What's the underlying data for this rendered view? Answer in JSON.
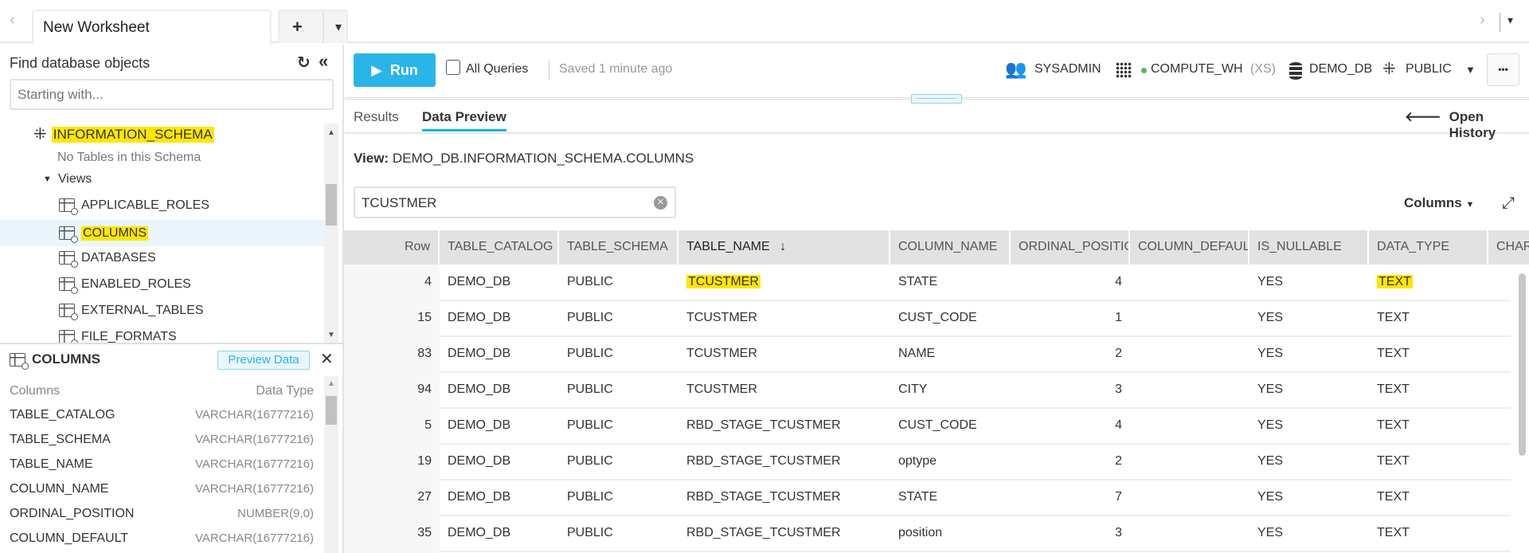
{
  "tabs": {
    "active": "New Worksheet",
    "add": "+",
    "menu": "▾",
    "nav_left": "‹",
    "nav_right": "›"
  },
  "left": {
    "title": "Find database objects",
    "search_placeholder": "Starting with...",
    "schema": "INFORMATION_SCHEMA",
    "no_tables": "No Tables in this Schema",
    "views_label": "Views",
    "views": [
      "APPLICABLE_ROLES",
      "COLUMNS",
      "DATABASES",
      "ENABLED_ROLES",
      "EXTERNAL_TABLES",
      "FILE_FORMATS"
    ],
    "detail": {
      "title": "COLUMNS",
      "preview_button": "Preview Data",
      "close": "✕",
      "col_header": "Columns",
      "type_header": "Data Type",
      "columns": [
        {
          "name": "TABLE_CATALOG",
          "type": "VARCHAR(16777216)"
        },
        {
          "name": "TABLE_SCHEMA",
          "type": "VARCHAR(16777216)"
        },
        {
          "name": "TABLE_NAME",
          "type": "VARCHAR(16777216)"
        },
        {
          "name": "COLUMN_NAME",
          "type": "VARCHAR(16777216)"
        },
        {
          "name": "ORDINAL_POSITION",
          "type": "NUMBER(9,0)"
        },
        {
          "name": "COLUMN_DEFAULT",
          "type": "VARCHAR(16777216)"
        }
      ]
    }
  },
  "toolbar": {
    "run": "Run",
    "all_queries": "All Queries",
    "saved": "Saved 1 minute ago",
    "role": "SYSADMIN",
    "warehouse": "COMPUTE_WH",
    "warehouse_size": "(XS)",
    "database": "DEMO_DB",
    "schema": "PUBLIC",
    "more": "•••"
  },
  "results": {
    "tabs": [
      "Results",
      "Data Preview"
    ],
    "open_history": "Open History",
    "view_label": "View:",
    "view_name": "DEMO_DB.INFORMATION_SCHEMA.COLUMNS",
    "filter_value": "TCUSTMER",
    "columns_button": "Columns",
    "headers": [
      "Row",
      "TABLE_CATALOG",
      "TABLE_SCHEMA",
      "TABLE_NAME",
      "COLUMN_NAME",
      "ORDINAL_POSITION",
      "COLUMN_DEFAULT",
      "IS_NULLABLE",
      "DATA_TYPE",
      "CHARACTER_MAXIMUM_LENGTH"
    ],
    "sort_indicator": "↓",
    "rows": [
      [
        "4",
        "DEMO_DB",
        "PUBLIC",
        "TCUSTMER",
        "STATE",
        "4",
        "",
        "YES",
        "TEXT"
      ],
      [
        "15",
        "DEMO_DB",
        "PUBLIC",
        "TCUSTMER",
        "CUST_CODE",
        "1",
        "",
        "YES",
        "TEXT"
      ],
      [
        "83",
        "DEMO_DB",
        "PUBLIC",
        "TCUSTMER",
        "NAME",
        "2",
        "",
        "YES",
        "TEXT"
      ],
      [
        "94",
        "DEMO_DB",
        "PUBLIC",
        "TCUSTMER",
        "CITY",
        "3",
        "",
        "YES",
        "TEXT"
      ],
      [
        "5",
        "DEMO_DB",
        "PUBLIC",
        "RBD_STAGE_TCUSTMER",
        "CUST_CODE",
        "4",
        "",
        "YES",
        "TEXT"
      ],
      [
        "19",
        "DEMO_DB",
        "PUBLIC",
        "RBD_STAGE_TCUSTMER",
        "optype",
        "2",
        "",
        "YES",
        "TEXT"
      ],
      [
        "27",
        "DEMO_DB",
        "PUBLIC",
        "RBD_STAGE_TCUSTMER",
        "STATE",
        "7",
        "",
        "YES",
        "TEXT"
      ],
      [
        "35",
        "DEMO_DB",
        "PUBLIC",
        "RBD_STAGE_TCUSTMER",
        "position",
        "3",
        "",
        "YES",
        "TEXT"
      ]
    ]
  },
  "colors": {
    "accent": "#29b5e8",
    "highlight": "#ffe600",
    "warehouse_status": "#5cb85c"
  }
}
